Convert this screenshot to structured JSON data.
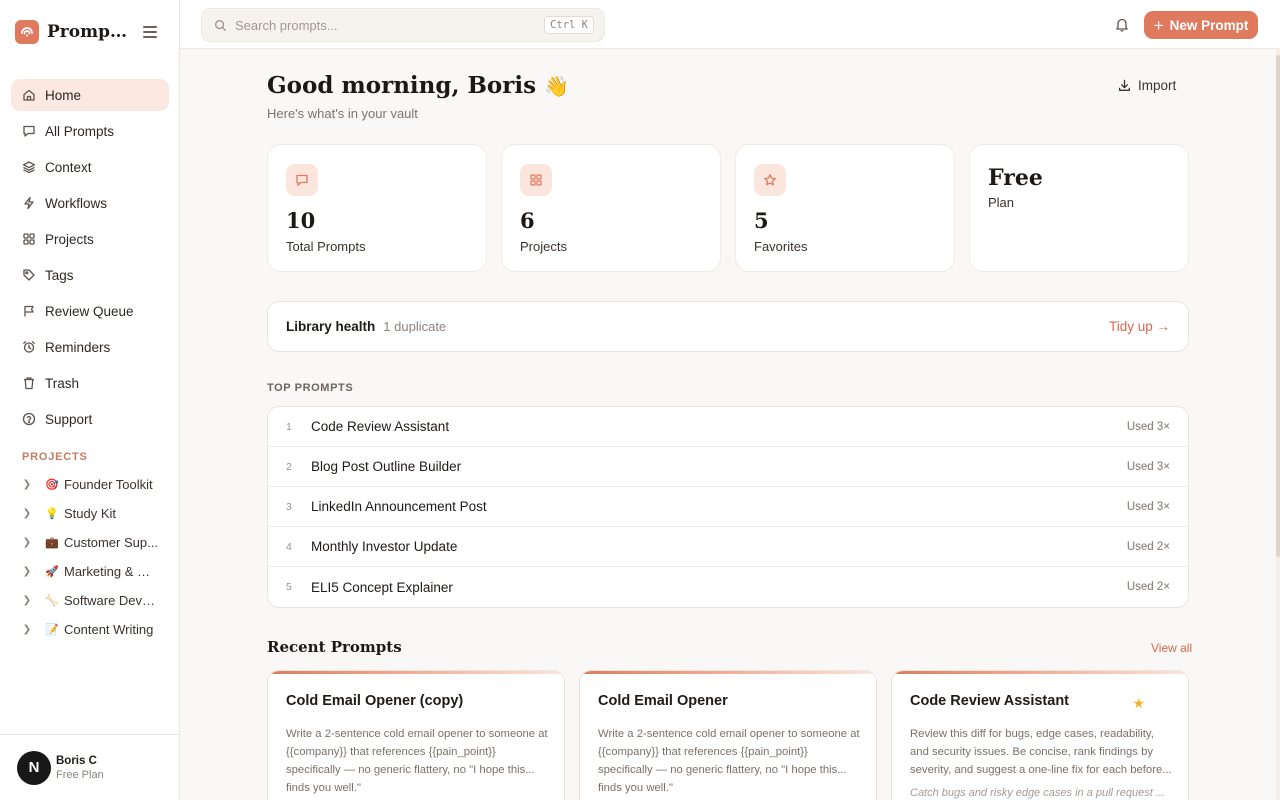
{
  "app": {
    "name": "PromptA..."
  },
  "nav": {
    "items": [
      {
        "label": "Home",
        "icon": "home-icon",
        "active": true
      },
      {
        "label": "All Prompts",
        "icon": "message-icon"
      },
      {
        "label": "Context",
        "icon": "layers-icon"
      },
      {
        "label": "Workflows",
        "icon": "bolt-icon"
      },
      {
        "label": "Projects",
        "icon": "grid-icon"
      },
      {
        "label": "Tags",
        "icon": "tag-icon"
      },
      {
        "label": "Review Queue",
        "icon": "flag-icon"
      },
      {
        "label": "Reminders",
        "icon": "alarm-icon"
      },
      {
        "label": "Trash",
        "icon": "trash-icon"
      },
      {
        "label": "Support",
        "icon": "help-icon"
      }
    ]
  },
  "projects": {
    "heading": "PROJECTS",
    "items": [
      {
        "emoji": "🎯",
        "name": "Founder Toolkit"
      },
      {
        "emoji": "💡",
        "name": "Study Kit"
      },
      {
        "emoji": "💼",
        "name": "Customer Sup..."
      },
      {
        "emoji": "🚀",
        "name": "Marketing & Gr..."
      },
      {
        "emoji": "🦴",
        "name": "Software Devel..."
      },
      {
        "emoji": "📝",
        "name": "Content Writing"
      }
    ]
  },
  "user": {
    "initial": "N",
    "name": "Boris C",
    "plan": "Free Plan"
  },
  "topbar": {
    "search_placeholder": "Search prompts...",
    "shortcut": "Ctrl K",
    "new_prompt_label": "New Prompt"
  },
  "header": {
    "greeting": "Good morning, Boris",
    "wave": "👋",
    "subtitle": "Here's what's in your vault",
    "import_label": "Import"
  },
  "stats": [
    {
      "value": "10",
      "label": "Total Prompts",
      "icon": "message-icon"
    },
    {
      "value": "6",
      "label": "Projects",
      "icon": "grid-icon"
    },
    {
      "value": "5",
      "label": "Favorites",
      "icon": "star-icon"
    },
    {
      "value": "Free",
      "label": "Plan"
    }
  ],
  "health": {
    "title": "Library health",
    "count": "1 duplicate",
    "action": "Tidy up →"
  },
  "top_prompts": {
    "heading": "TOP PROMPTS",
    "items": [
      {
        "rank": "1",
        "name": "Code Review Assistant",
        "used": "Used 3×"
      },
      {
        "rank": "2",
        "name": "Blog Post Outline Builder",
        "used": "Used 3×"
      },
      {
        "rank": "3",
        "name": "LinkedIn Announcement Post",
        "used": "Used 3×"
      },
      {
        "rank": "4",
        "name": "Monthly Investor Update",
        "used": "Used 2×"
      },
      {
        "rank": "5",
        "name": "ELI5 Concept Explainer",
        "used": "Used 2×"
      }
    ]
  },
  "recent": {
    "heading": "Recent Prompts",
    "view_all": "View all",
    "cards": [
      {
        "title": "Cold Email Opener (copy)",
        "body": "Write a 2-sentence cold email opener to someone at {{company}} that references {{pain_point}} specifically — no generic flattery, no \"I hope this... finds you well.\"",
        "favorite": false,
        "footer": ""
      },
      {
        "title": "Cold Email Opener",
        "body": "Write a 2-sentence cold email opener to someone at {{company}} that references {{pain_point}} specifically — no generic flattery, no \"I hope this... finds you well.\"",
        "favorite": false,
        "footer": ""
      },
      {
        "title": "Code Review Assistant",
        "body": "Review this diff for bugs, edge cases, readability, and security issues. Be concise, rank findings by severity, and suggest a one-line fix for each before...",
        "favorite": true,
        "star": "★",
        "footer": "Catch bugs and risky edge cases in a pull request ..."
      }
    ]
  },
  "colors": {
    "accent": "#e07a5f",
    "accent_soft": "#fbe6dd",
    "star": "#f2b231"
  }
}
